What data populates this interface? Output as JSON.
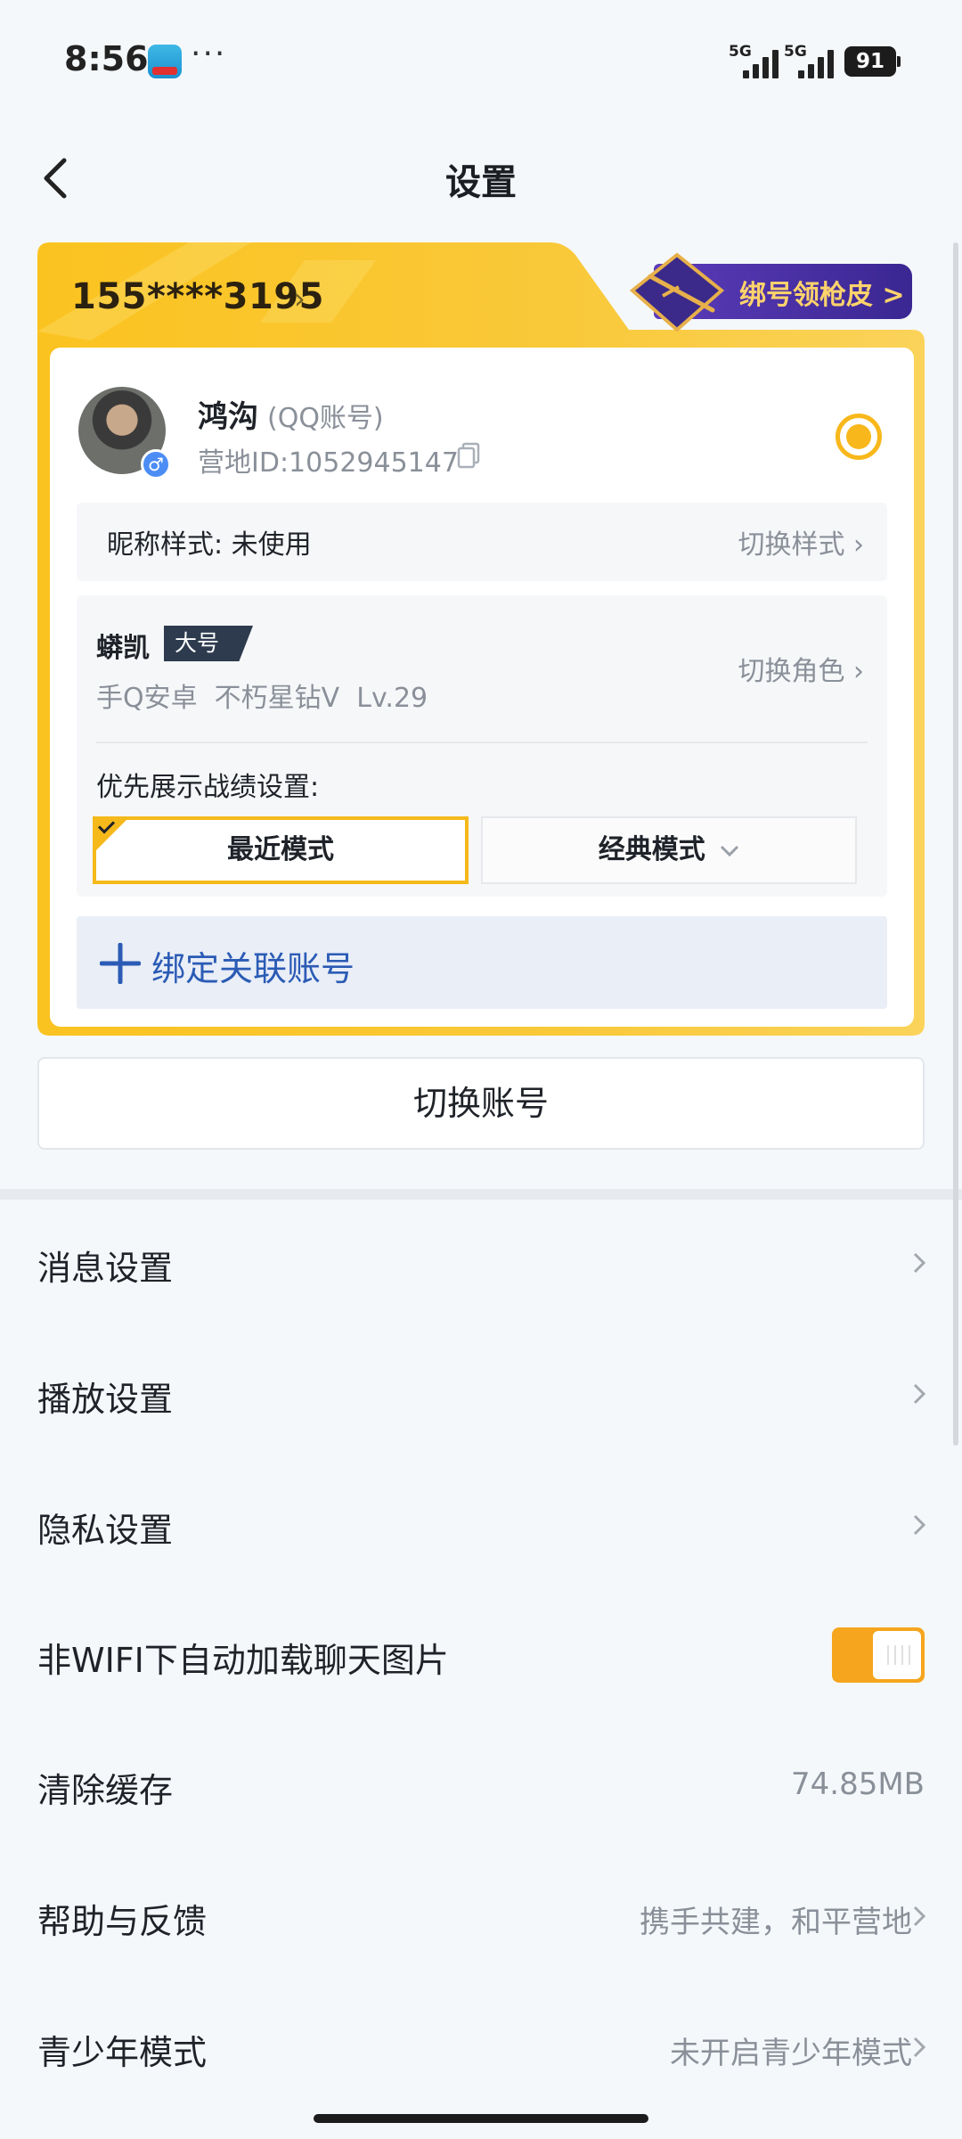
{
  "status_bar": {
    "time": "8:56",
    "more": "···",
    "signal_1_label": "5G",
    "signal_2_label": "5G",
    "battery": "91"
  },
  "header": {
    "title": "设置",
    "back_icon": "back-arrow-icon"
  },
  "account_card": {
    "phone": "155****3195",
    "promo_label": "绑号领枪皮 >",
    "profile": {
      "nickname": "鸿沟",
      "account_type": "(QQ账号)",
      "camp_id": "营地ID:1052945147",
      "gender": "♂"
    },
    "nick_style": {
      "label": "昵称样式: 未使用",
      "action": "切换样式"
    },
    "role": {
      "name": "蟒凯",
      "tag": "大号",
      "meta": "手Q安卓  不朽星钻Ⅴ  Lv.29",
      "action": "切换角色"
    },
    "record_setting": {
      "label": "优先展示战绩设置:",
      "recent_mode": "最近模式",
      "classic_mode": "经典模式"
    },
    "bind_label": "绑定关联账号"
  },
  "switch_account": "切换账号",
  "settings": [
    {
      "label": "消息设置",
      "value": ""
    },
    {
      "label": "播放设置",
      "value": ""
    },
    {
      "label": "隐私设置",
      "value": ""
    },
    {
      "label": "非WIFI下自动加载聊天图片",
      "toggle_on": true
    },
    {
      "label": "清除缓存",
      "value": "74.85MB"
    },
    {
      "label": "帮助与反馈",
      "value": "携手共建，和平营地"
    },
    {
      "label": "青少年模式",
      "value": "未开启青少年模式"
    }
  ],
  "colors": {
    "accent_yellow": "#f8b81c",
    "link_blue": "#2b5bb5",
    "promo_purple": "#4a2fa6"
  }
}
